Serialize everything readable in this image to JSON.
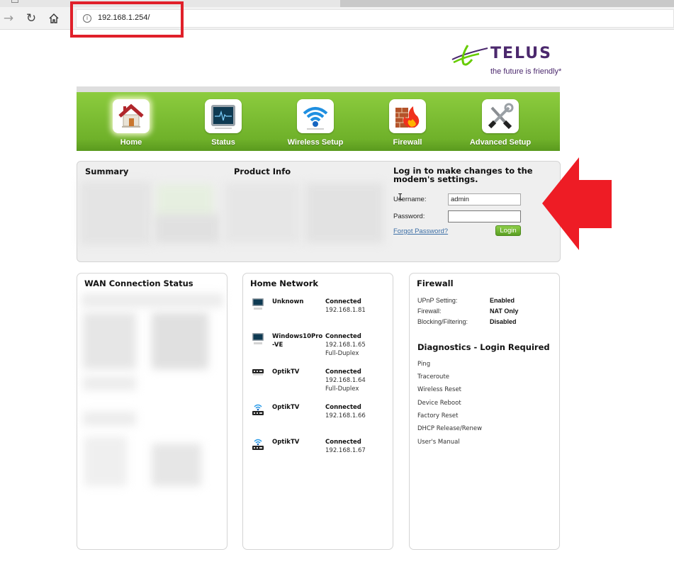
{
  "browser": {
    "url": "192.168.1.254/",
    "icons": {
      "forward": "arrow-right-icon",
      "reload": "reload-icon",
      "home": "home-icon",
      "site_info": "info-icon"
    }
  },
  "brand": {
    "name": "TELUS",
    "tagline": "the future is friendly*",
    "colors": {
      "purple": "#4b286d",
      "green": "#66cc00"
    }
  },
  "nav": {
    "items": [
      {
        "label": "Home",
        "icon": "house-icon",
        "active": true
      },
      {
        "label": "Status",
        "icon": "monitor-pulse-icon",
        "active": false
      },
      {
        "label": "Wireless Setup",
        "icon": "wifi-icon",
        "active": false
      },
      {
        "label": "Firewall",
        "icon": "firewall-flame-icon",
        "active": false
      },
      {
        "label": "Advanced Setup",
        "icon": "tools-icon",
        "active": false
      }
    ]
  },
  "summary": {
    "title": "Summary",
    "product_info_title": "Product Info",
    "login": {
      "title": "Log in to make changes to the modem's settings.",
      "username_label": "Username:",
      "username_value": "admin",
      "password_label": "Password:",
      "password_value": "",
      "forgot_label": "Forgot Password?",
      "login_button": "Login"
    }
  },
  "wan": {
    "title": "WAN Connection Status"
  },
  "home_network": {
    "title": "Home Network",
    "devices": [
      {
        "name": "Unknown",
        "status": "Connected",
        "ip": "192.168.1.81",
        "duplex": "",
        "icon": "computer-icon"
      },
      {
        "name": "Windows10Pro-VE",
        "status": "Connected",
        "ip": "192.168.1.65",
        "duplex": "Full-Duplex",
        "icon": "computer-icon"
      },
      {
        "name": "OptikTV",
        "status": "Connected",
        "ip": "192.168.1.64",
        "duplex": "Full-Duplex",
        "icon": "set-top-box-icon"
      },
      {
        "name": "OptikTV",
        "status": "Connected",
        "ip": "192.168.1.66",
        "duplex": "",
        "icon": "wireless-set-top-box-icon"
      },
      {
        "name": "OptikTV",
        "status": "Connected",
        "ip": "192.168.1.67",
        "duplex": "",
        "icon": "wireless-set-top-box-icon"
      }
    ]
  },
  "firewall": {
    "title": "Firewall",
    "rows": [
      {
        "key": "UPnP Setting:",
        "value": "Enabled"
      },
      {
        "key": "Firewall:",
        "value": "NAT Only"
      },
      {
        "key": "Blocking/Filtering:",
        "value": "Disabled"
      }
    ],
    "diagnostics_title": "Diagnostics - Login Required",
    "diagnostics": [
      "Ping",
      "Traceroute",
      "Wireless Reset",
      "Device Reboot",
      "Factory Reset",
      "DHCP Release/Renew",
      "User's Manual"
    ]
  },
  "annotations": {
    "highlight_color": "#e0202a",
    "arrow_color": "#ee1c25"
  }
}
